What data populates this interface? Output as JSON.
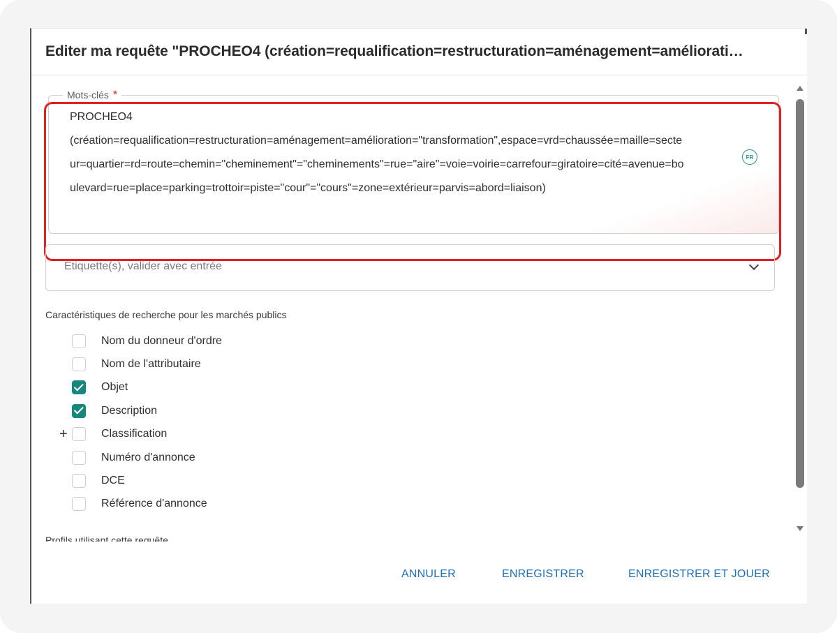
{
  "dialog": {
    "title": "Editer ma requête \"PROCHEO4 (création=requalification=restructuration=aménagement=améliorati…"
  },
  "keywords": {
    "label": "Mots-clés",
    "required_mark": "*",
    "value": "PROCHEO4\n(création=requalification=restructuration=aménagement=amélioration=\"transformation\",espace=vrd=chaussée=maille=secteur=quartier=rd=route=chemin=\"cheminement\"=\"cheminements\"=rue=\"aire\"=voie=voirie=carrefour=giratoire=cité=avenue=boulevard=rue=place=parking=trottoir=piste=\"cour\"=\"cours\"=zone=extérieur=parvis=abord=liaison)",
    "language_badge": "FR"
  },
  "tags": {
    "placeholder": "Etiquette(s), valider avec entrée"
  },
  "search_characteristics": {
    "label": "Caractéristiques de recherche pour les marchés publics",
    "items": [
      {
        "label": "Nom du donneur d'ordre",
        "checked": false
      },
      {
        "label": "Nom de l'attributaire",
        "checked": false
      },
      {
        "label": "Objet",
        "checked": true
      },
      {
        "label": "Description",
        "checked": true
      },
      {
        "label": "Classification",
        "checked": false
      },
      {
        "label": "Numéro d'annonce",
        "checked": false
      },
      {
        "label": "DCE",
        "checked": false
      },
      {
        "label": "Référence d'annonce",
        "checked": false
      }
    ],
    "expand_symbol": "+"
  },
  "profiles": {
    "label": "Profils utilisant cette requête"
  },
  "actions": {
    "cancel": "ANNULER",
    "save": "ENREGISTRER",
    "save_and_run": "ENREGISTRER ET JOUER"
  },
  "colors": {
    "accent": "#1f6fb6",
    "checkbox_checked": "#17877d",
    "highlight": "#e32020"
  }
}
